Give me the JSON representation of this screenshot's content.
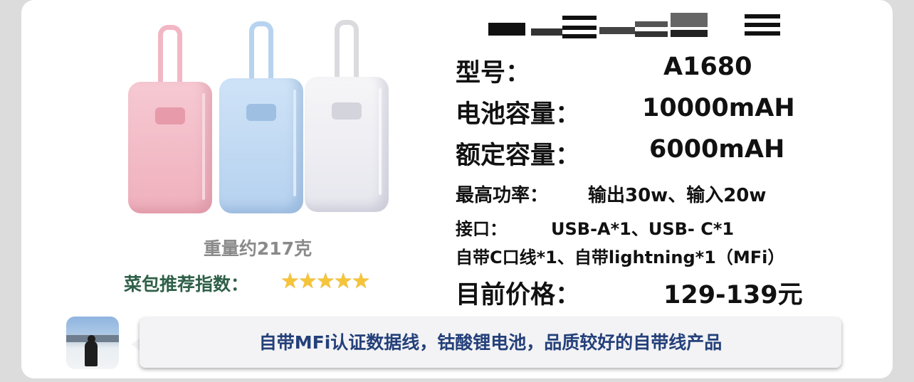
{
  "product": {
    "weight_text": "重量约217克",
    "rating_label": "菜包推荐指数：",
    "rating_stars": 5,
    "colors": [
      "pink",
      "blue",
      "white"
    ]
  },
  "specs": {
    "model_label": "型号：",
    "model_value": "A1680",
    "capacity_label": "电池容量：",
    "capacity_value": "10000mAH",
    "rated_label": "额定容量：",
    "rated_value": "6000mAH",
    "power_label": "最高功率：",
    "power_value": "输出30w、输入20w",
    "port_label": "接口：",
    "port_value": "USB-A*1、USB- C*1",
    "cable_text": "自带C口线*1、自带lightning*1（MFi）",
    "price_label": "目前价格：",
    "price_value": "129-139元"
  },
  "comment": {
    "text": "自带MFi认证数据线，钴酸锂电池，品质较好的自带线产品"
  }
}
